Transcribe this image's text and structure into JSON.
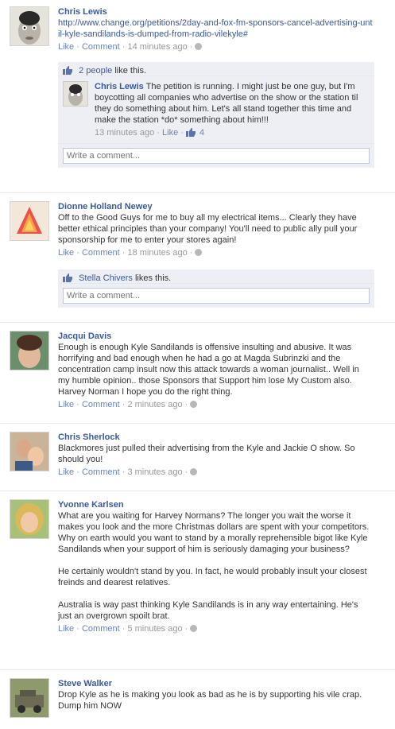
{
  "common": {
    "like": "Like",
    "comment": "Comment",
    "dot": "·"
  },
  "posts": [
    {
      "author": "Chris Lewis",
      "text": "http://www.change.org/petitions/2day-and-fox-fm-sponsors-cancel-advertising-until-kyle-sandilands-is-dumped-from-radio-vilekyle#",
      "time": "14 minutes ago",
      "likes_link": "2 people",
      "likes_suffix": " like this.",
      "reply": {
        "author": "Chris Lewis",
        "text": "The petition is running. I might just be one guy, but I'm boycotting all companies who advertise on the show or the station til they do something about him. Let's all stand together this time and make the station *do* something about him!!!",
        "time": "13 minutes ago",
        "like": "Like",
        "like_count": "4"
      },
      "write_placeholder": "Write a comment..."
    },
    {
      "author": "Dionne Holland Newey",
      "text": "Off to the Good Guys for me to buy all my electrical items... Clearly they have better ethical principles than your company! You'll need to public ally pull your sponsorship for me to enter your stores again!",
      "time": "18 minutes ago",
      "likes_link": "Stella Chivers",
      "likes_suffix": " likes this.",
      "write_placeholder": "Write a comment..."
    },
    {
      "author": "Jacqui Davis",
      "text": "Enough is enough Kyle Sandilands is offensive insulting and abusive. It was horrifying and bad enough when he had a go at Magda Subrinzki and the concentration camp insult now this attack towards a woman journalist.. Well in my humble opinion.. those Sponsors that Support him lose My Custom also. Harvey Norman I hope you do the right thing.",
      "time": "2 minutes ago"
    },
    {
      "author": "Chris Sherlock",
      "text": "Blackmores just pulled their advertising from the Kyle and Jackie O show. So should you!",
      "time": "3 minutes ago"
    },
    {
      "author": "Yvonne Karlsen",
      "text": "What are you waiting for Harvey Normans? The longer you wait the worse it makes you look and the more Christmas dollars are spent with your competitors.\nWhy on earth would you want to stand by a morally reprehensible bigot like Kyle Sandilands when your support of him is seriously damaging your business?\n\nHe certainly wouldn't stand by you. In fact, he would probably insult your closest freinds and dearest relatives.\n\nAustralia is way past thinking Kyle Sandilands is in any way entertaining. He's just an overgrown spoilt brat.",
      "time": "5 minutes ago"
    },
    {
      "author": "Steve Walker",
      "text": "Drop Kyle as he is making you look as bad as he is by supporting his vile crap.\nDump him NOW"
    }
  ]
}
